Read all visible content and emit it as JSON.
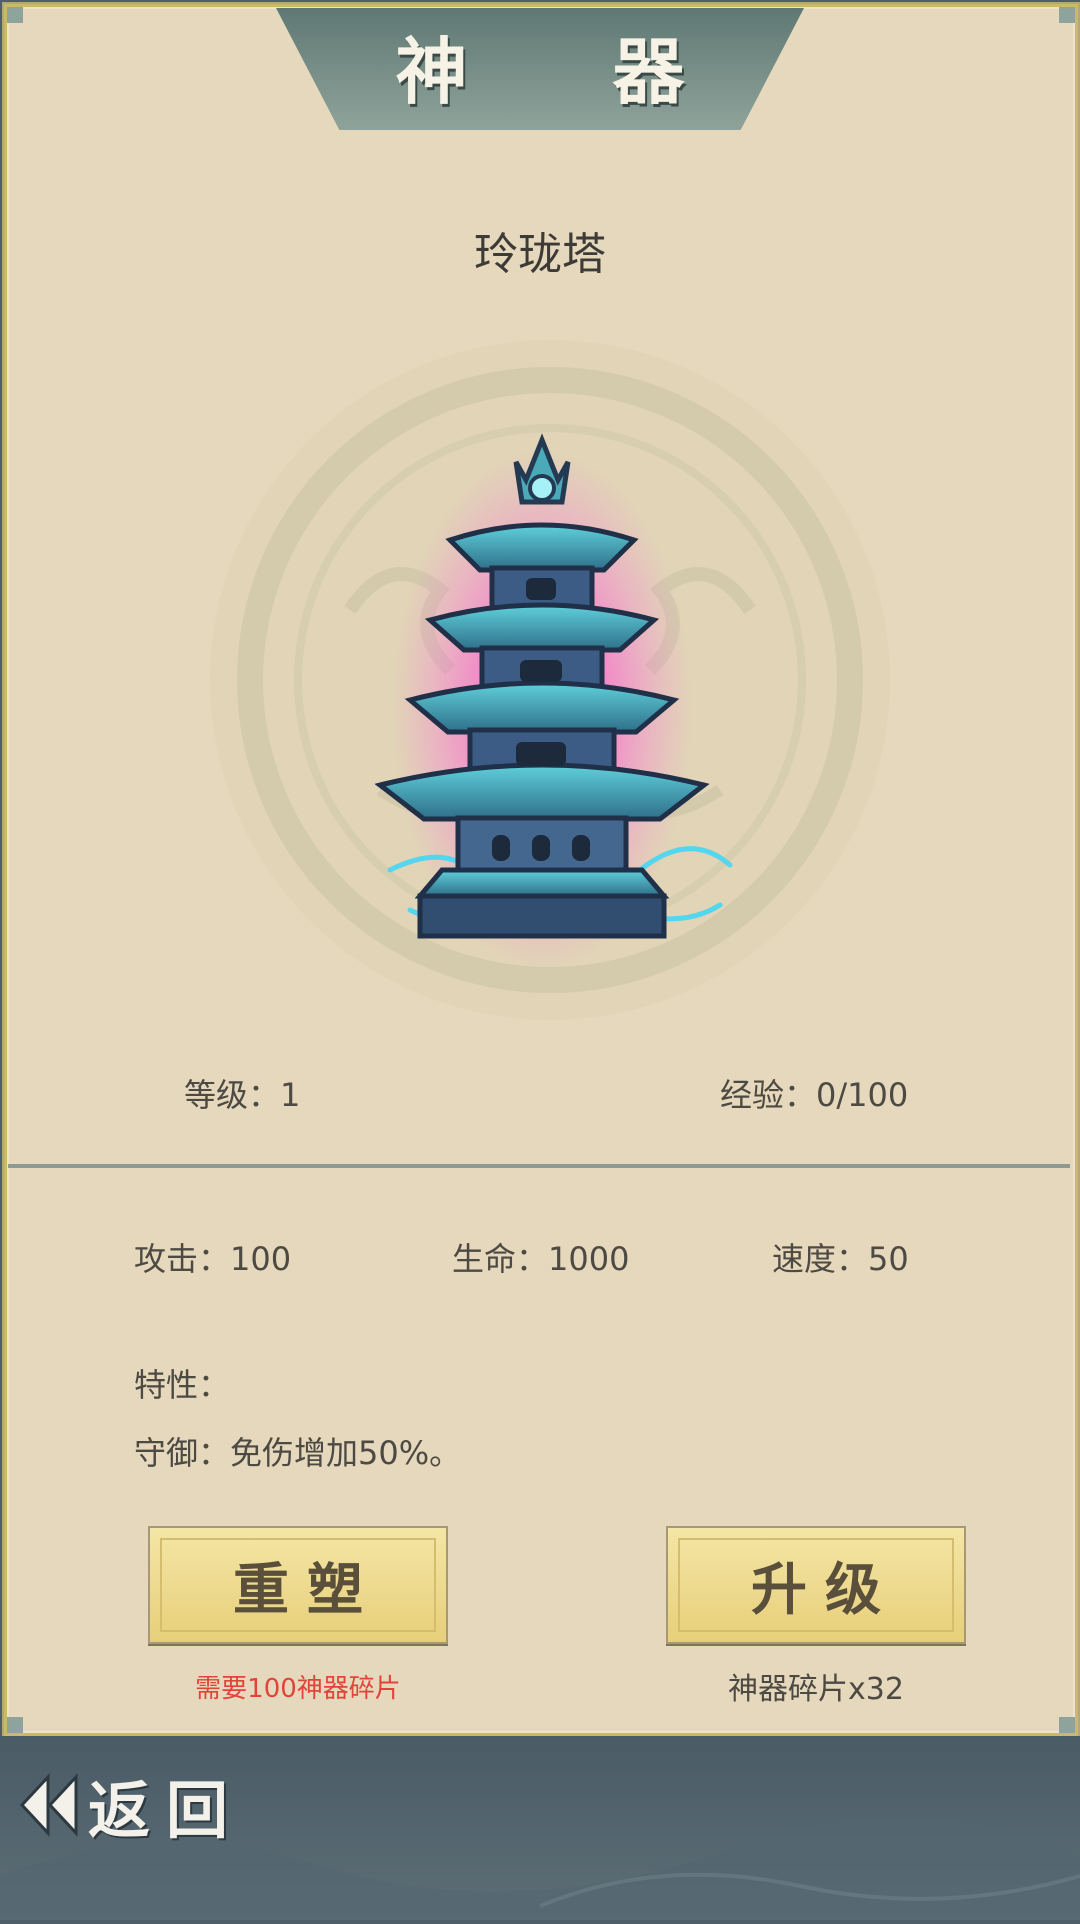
{
  "header": {
    "title": "神 器"
  },
  "artifact": {
    "name": "玲珑塔",
    "level_label": "等级：1",
    "exp_label": "经验：0/100",
    "stats": {
      "attack": "攻击：100",
      "health": "生命：1000",
      "speed": "速度：50"
    },
    "trait_heading": "特性：",
    "trait_text": "守御：免伤增加50%。"
  },
  "actions": {
    "reforge_label": "重塑",
    "reforge_note": "需要100神器碎片",
    "upgrade_label": "升级",
    "upgrade_note": "神器碎片x32"
  },
  "footer": {
    "back_label": "返回"
  },
  "colors": {
    "panel_bg": "#e6d8bc",
    "accent_teal": "#6b8480",
    "button_gold": "#efdc90",
    "warning_red": "#e0453a",
    "glow_pink": "#ff40d0",
    "tower_cyan": "#4fb8c8"
  },
  "icons": {
    "back": "double-left-arrow-icon",
    "artifact": "pagoda-tower-icon"
  }
}
